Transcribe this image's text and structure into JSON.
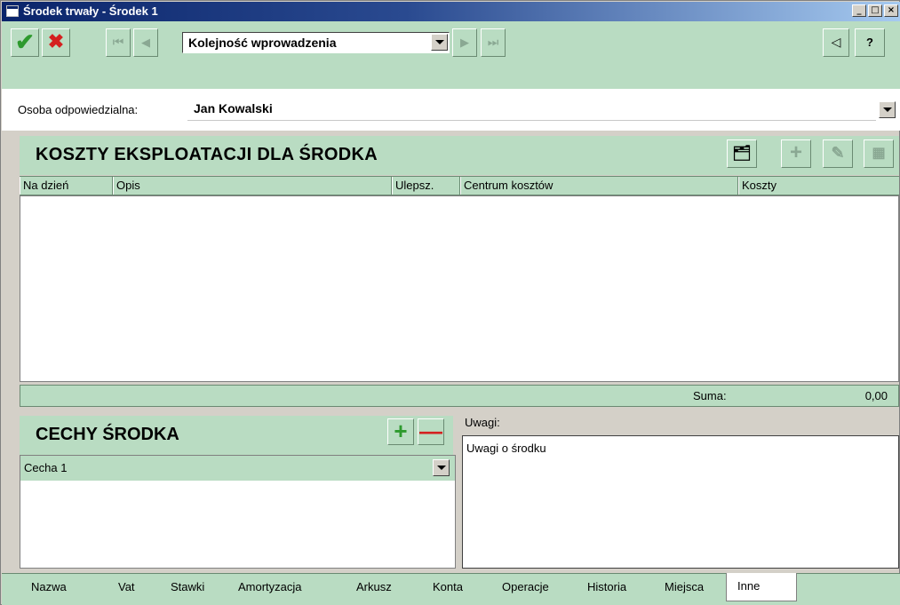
{
  "window": {
    "title": "Środek trwały - Środek 1",
    "controls": [
      "_",
      "□",
      "×"
    ]
  },
  "toolbar": {
    "ok_glyph": "✔",
    "cancel_glyph": "✖",
    "first_glyph": "⏮",
    "prev_glyph": "◀",
    "next_glyph": "▶",
    "last_glyph": "⏭",
    "order_value": "Kolejność wprowadzenia",
    "collapse_glyph": "◁",
    "help_label": "?"
  },
  "form": {
    "osoba_label": "Osoba odpowiedzialna:",
    "osoba_value": "Jan Kowalski"
  },
  "costs": {
    "title": "KOSZTY EKSPLOATACJI DLA ŚRODKA",
    "columns": [
      "Na dzień",
      "Opis",
      "Ulepsz.",
      "Centrum kosztów",
      "Koszty"
    ],
    "rows": [],
    "sum_label": "Suma:",
    "sum_value": "0,00",
    "button_glyphs": {
      "props": "🗂",
      "add": "+",
      "edit": "✎",
      "calc": "▦"
    }
  },
  "features": {
    "title": "CECHY ŚRODKA",
    "add_label": "+",
    "remove_label": "—",
    "selected": "Cecha 1"
  },
  "notes": {
    "label": "Uwagi:",
    "value": "Uwagi o środku"
  },
  "tabs": [
    "Nazwa",
    "Vat",
    "Stawki",
    "Amortyzacja",
    "Arkusz",
    "Konta",
    "Operacje",
    "Historia",
    "Miejsca",
    "Inne"
  ],
  "active_tab": "Inne",
  "colors": {
    "panel_green": "#b9dcc2",
    "ok_green": "#2e9a2e",
    "cancel_red": "#d42020",
    "titlebar_blue": "#0a246a"
  }
}
